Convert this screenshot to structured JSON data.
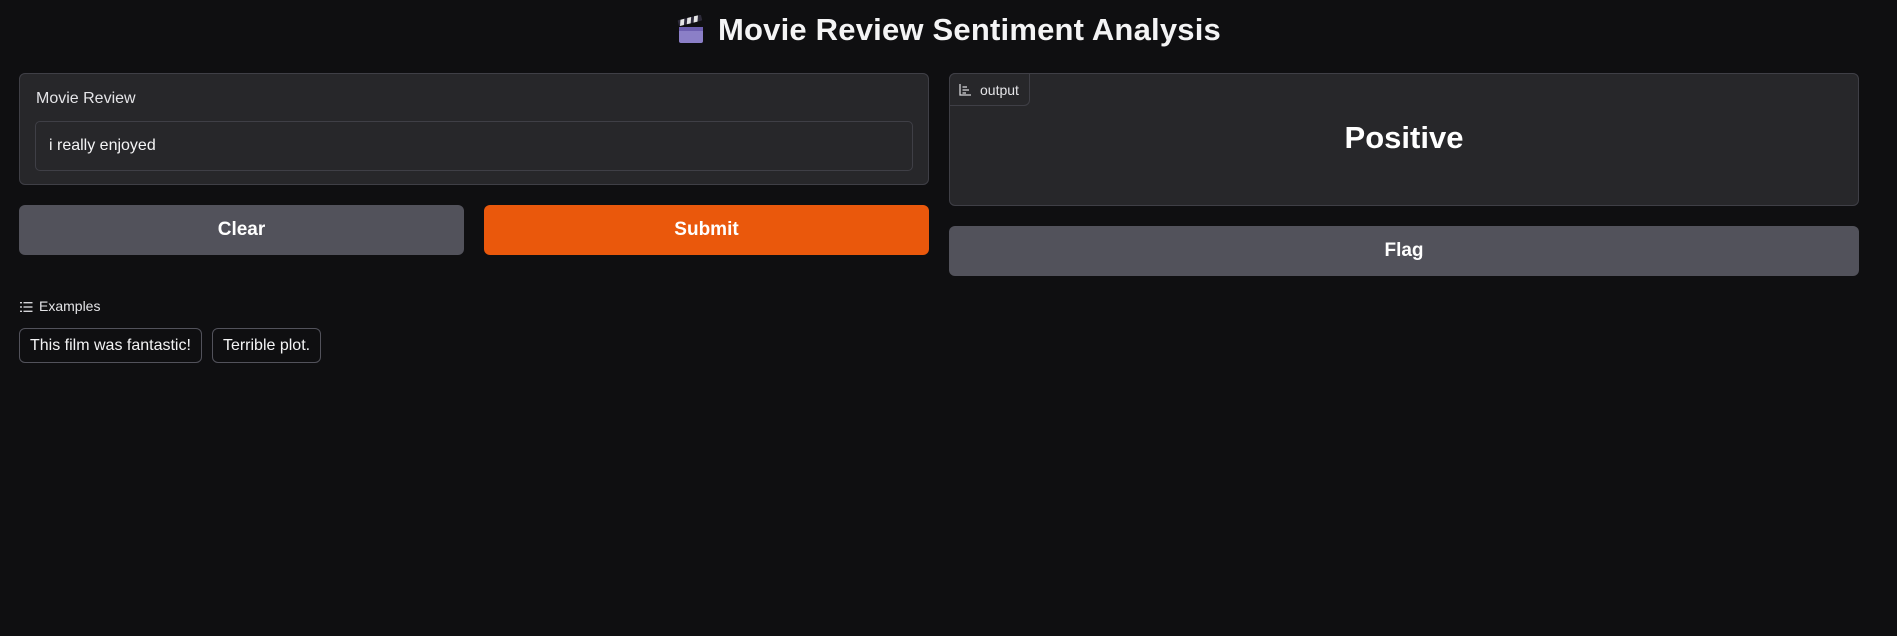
{
  "header": {
    "title": "Movie Review Sentiment Analysis",
    "icon": "clapperboard-icon"
  },
  "input": {
    "label": "Movie Review",
    "value": "i really enjoyed",
    "placeholder": ""
  },
  "actions": {
    "clear_label": "Clear",
    "submit_label": "Submit",
    "flag_label": "Flag"
  },
  "output": {
    "tag_label": "output",
    "tag_icon": "label-icon",
    "value": "Positive"
  },
  "examples": {
    "header": "Examples",
    "items": [
      "This film was fantastic!",
      "Terrible plot."
    ]
  },
  "colors": {
    "background": "#0f0f11",
    "panel": "#27272a",
    "primary": "#ea580c",
    "secondary": "#52525b"
  }
}
